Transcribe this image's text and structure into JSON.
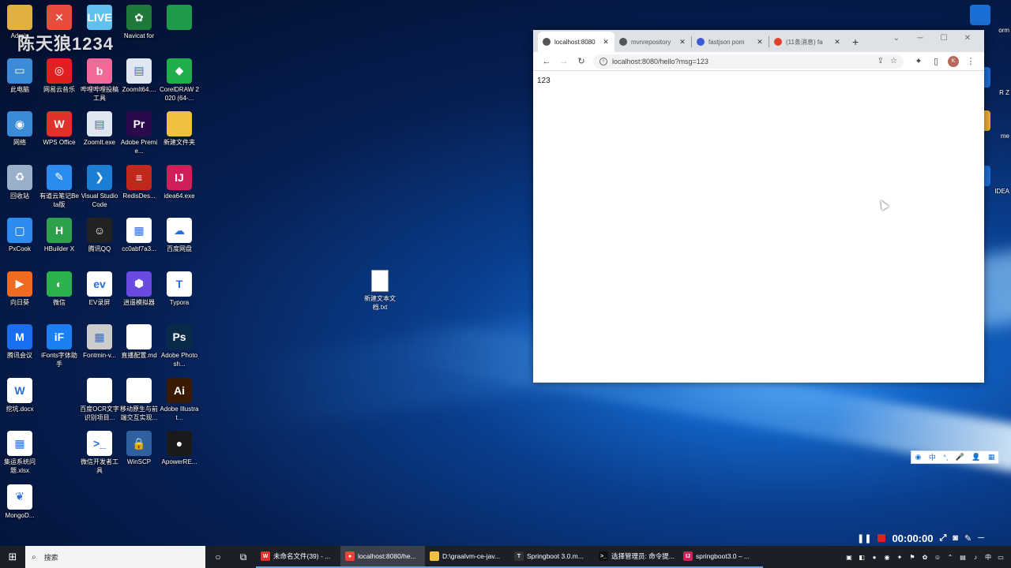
{
  "overlay": {
    "watermark": "陈天狼1234"
  },
  "desktop_icons": [
    {
      "label": "Admin",
      "icon": "user-folder-icon",
      "color": "#e0b040",
      "glyph": ""
    },
    {
      "label": "",
      "icon": "xmind-icon",
      "color": "#e74c3c",
      "glyph": "✕"
    },
    {
      "label": "",
      "icon": "bilibili-live-icon",
      "color": "#60c0f0",
      "glyph": "LIVE"
    },
    {
      "label": "Navicat for",
      "icon": "navicat-icon",
      "color": "#1e7a3a",
      "glyph": "✿"
    },
    {
      "label": "",
      "icon": "excel-file-icon",
      "color": "#1d9a4a",
      "glyph": ""
    },
    {
      "label": "此电脑",
      "icon": "computer-icon",
      "color": "#3b8bd9",
      "glyph": "▭"
    },
    {
      "label": "网易云音乐",
      "icon": "netease-music-icon",
      "color": "#e02020",
      "glyph": "◎"
    },
    {
      "label": "哔哩哔哩投稿工具",
      "icon": "bilibili-upload-icon",
      "color": "#f06a9a",
      "glyph": "b"
    },
    {
      "label": "ZoomIt64....",
      "icon": "zoomit64-icon",
      "color": "#dfe8f0",
      "glyph": "▤"
    },
    {
      "label": "CorelDRAW 2020 (64-...",
      "icon": "coreldraw-icon",
      "color": "#1fae4a",
      "glyph": "◆"
    },
    {
      "label": "网络",
      "icon": "network-icon",
      "color": "#3b8bd9",
      "glyph": "◉"
    },
    {
      "label": "WPS Office",
      "icon": "wps-icon",
      "color": "#e0312b",
      "glyph": "W"
    },
    {
      "label": "ZoomIt.exe",
      "icon": "zoomit-icon",
      "color": "#dfe8f0",
      "glyph": "▤"
    },
    {
      "label": "Adobe Premie...",
      "icon": "premiere-icon",
      "color": "#2a0a4a",
      "glyph": "Pr"
    },
    {
      "label": "新建文件夹",
      "icon": "folder-icon",
      "color": "#f0c040",
      "glyph": ""
    },
    {
      "label": "回收站",
      "icon": "recycle-bin-icon",
      "color": "#9ab0c8",
      "glyph": "♻"
    },
    {
      "label": "有道云笔记Beta版",
      "icon": "youdao-note-icon",
      "color": "#2b8cf0",
      "glyph": "✎"
    },
    {
      "label": "Visual Studio Code",
      "icon": "vscode-icon",
      "color": "#1b7fd6",
      "glyph": "❯"
    },
    {
      "label": "RedisDes...",
      "icon": "redis-icon",
      "color": "#c0281e",
      "glyph": "≡"
    },
    {
      "label": "idea64.exe",
      "icon": "intellij-icon",
      "color": "#d0205a",
      "glyph": "IJ"
    },
    {
      "label": "PxCook",
      "icon": "pxcook-icon",
      "color": "#2d8cf0",
      "glyph": "▢"
    },
    {
      "label": "HBuilder X",
      "icon": "hbuilder-icon",
      "color": "#2ca04a",
      "glyph": "H"
    },
    {
      "label": "腾讯QQ",
      "icon": "qq-icon",
      "color": "#222222",
      "glyph": "☺"
    },
    {
      "label": "cc0abf7a3...",
      "icon": "qrcode-icon",
      "color": "#ffffff",
      "glyph": "▦"
    },
    {
      "label": "百度网盘",
      "icon": "baidu-netdisk-icon",
      "color": "#ffffff",
      "glyph": "☁"
    },
    {
      "label": "向日葵",
      "icon": "sunflower-icon",
      "color": "#f06a20",
      "glyph": "▶"
    },
    {
      "label": "微信",
      "icon": "wechat-icon",
      "color": "#2bb24c",
      "glyph": "◐"
    },
    {
      "label": "EV录屏",
      "icon": "ev-recorder-icon",
      "color": "#ffffff",
      "glyph": "ev"
    },
    {
      "label": "逍遥模拟器",
      "icon": "emulator-icon",
      "color": "#6a4ae0",
      "glyph": "⬢"
    },
    {
      "label": "Typora",
      "icon": "typora-icon",
      "color": "#ffffff",
      "glyph": "T"
    },
    {
      "label": "腾讯会议",
      "icon": "tencent-meeting-icon",
      "color": "#1a6ff0",
      "glyph": "M"
    },
    {
      "label": "iFonts字体助手",
      "icon": "ifonts-icon",
      "color": "#1a7ff0",
      "glyph": "iF"
    },
    {
      "label": "Fontmin-v...",
      "icon": "fontmin-icon",
      "color": "#cccccc",
      "glyph": "▦"
    },
    {
      "label": "直播配置.md",
      "icon": "md-file-icon",
      "color": "#ffffff",
      "glyph": ""
    },
    {
      "label": "Adobe Photosh...",
      "icon": "photoshop-icon",
      "color": "#0a2a4a",
      "glyph": "Ps"
    },
    {
      "label": "挖坑.docx",
      "icon": "word-file-icon",
      "color": "#ffffff",
      "glyph": "W"
    },
    {
      "label": "",
      "icon": "empty-slot",
      "color": "",
      "glyph": ""
    },
    {
      "label": "百度OCR文字识别项目...",
      "icon": "text-file-icon",
      "color": "#ffffff",
      "glyph": ""
    },
    {
      "label": "移动原生与前端交互实现...",
      "icon": "text-file-icon-2",
      "color": "#ffffff",
      "glyph": ""
    },
    {
      "label": "Adobe Illustrat...",
      "icon": "illustrator-icon",
      "color": "#3a1a00",
      "glyph": "Ai"
    },
    {
      "label": "集运系统问题.xlsx",
      "icon": "xlsx-file-icon",
      "color": "#ffffff",
      "glyph": "▦"
    },
    {
      "label": "",
      "icon": "empty-slot-2",
      "color": "",
      "glyph": ""
    },
    {
      "label": "微信开发者工具",
      "icon": "wechat-devtools-icon",
      "color": "#ffffff",
      "glyph": ">_"
    },
    {
      "label": "WinSCP",
      "icon": "winscp-icon",
      "color": "#3060a0",
      "glyph": "🔒"
    },
    {
      "label": "ApowerRE...",
      "icon": "apowerrec-icon",
      "color": "#1a1a1a",
      "glyph": "●"
    },
    {
      "label": "MongoD...",
      "icon": "mongodb-icon",
      "color": "#ffffff",
      "glyph": "❦"
    }
  ],
  "right_icons": [
    {
      "label": "orm",
      "icon": "webstorm-icon"
    },
    {
      "label": "R Z",
      "icon": "app-icon"
    },
    {
      "label": "me",
      "icon": "chrome-icon"
    },
    {
      "label": "IDEA",
      "icon": "idea-icon"
    }
  ],
  "desk_file": {
    "label": "新建文本文档.txt"
  },
  "browser": {
    "tabs": [
      {
        "title": "localhost:8080",
        "active": true,
        "favicon_color": "#555555",
        "icon": "globe-icon"
      },
      {
        "title": "mvnrepository",
        "active": false,
        "favicon_color": "#555555",
        "icon": "globe-icon"
      },
      {
        "title": "fastjson pom",
        "active": false,
        "favicon_color": "#3b5bd9",
        "icon": "fastjson-icon"
      },
      {
        "title": "(11条消息) fa",
        "active": false,
        "favicon_color": "#e0402a",
        "icon": "csdn-icon"
      }
    ],
    "new_tab": "+",
    "url": "localhost:8080/hello?msg=123",
    "profile_initial": "K",
    "content": "123"
  },
  "ime": {
    "items": [
      "中",
      "°,",
      "🎤",
      "👤",
      "▦"
    ]
  },
  "recorder": {
    "time": "00:00:00"
  },
  "taskbar": {
    "search_placeholder": "搜索",
    "tasks": [
      {
        "label": "未命名文件(39) - ...",
        "icon": "wps-icon",
        "color": "#e0312b",
        "glyph": "W"
      },
      {
        "label": "localhost:8080/he...",
        "icon": "chrome-icon",
        "color": "#ea4335",
        "glyph": "●"
      },
      {
        "label": "D:\\graalvm-ce-jav...",
        "icon": "folder-icon",
        "color": "#f0c040",
        "glyph": ""
      },
      {
        "label": "Springboot 3.0.m...",
        "icon": "typora-icon",
        "color": "#333333",
        "glyph": "T"
      },
      {
        "label": "选择管理员: 命令提...",
        "icon": "cmd-icon",
        "color": "#111111",
        "glyph": ">_"
      },
      {
        "label": "springboot3.0 – ...",
        "icon": "intellij-icon",
        "color": "#d0205a",
        "glyph": "IJ"
      }
    ]
  }
}
